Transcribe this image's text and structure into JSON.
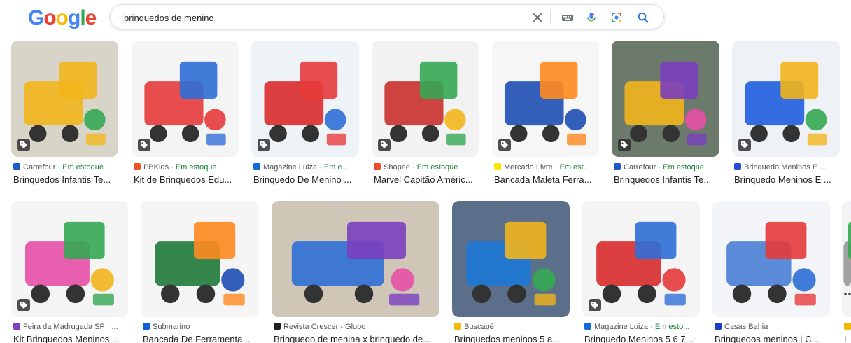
{
  "search": {
    "query": "brinquedos de menino",
    "logo_letters": [
      "G",
      "o",
      "o",
      "g",
      "l",
      "e"
    ],
    "logo_colors": [
      "#4285F4",
      "#EA4335",
      "#FBBC05",
      "#4285F4",
      "#34A853",
      "#EA4335"
    ],
    "icons": [
      "close-icon",
      "keyboard-icon",
      "microphone-icon",
      "lens-icon",
      "search-icon"
    ]
  },
  "colors": {
    "accent": "#1a73e8",
    "stock_green": "#188038",
    "source_gray": "#4d5156"
  },
  "row1": [
    {
      "source": "Carrefour",
      "stock": " · Em estoque",
      "title": "Brinquedos Infantis Te...",
      "fav": "#1e5bc6",
      "bg": "#d9d4c8",
      "accent": "#f2b51c"
    },
    {
      "source": "PBKids",
      "stock": " · Em estoque",
      "title": "Kit de Brinquedos Edu...",
      "fav": "#e8552b",
      "bg": "#f4f4f4",
      "accent": "#e63b3b"
    },
    {
      "source": "Magazine Luiza",
      "stock": " · Em e...",
      "title": "Brinquedo De Menino ...",
      "fav": "#0f6bd6",
      "bg": "#eef3f8",
      "accent": "#d92b2b"
    },
    {
      "source": "Shopee",
      "stock": " · Em estoque",
      "title": "Marvel Capitão Améric...",
      "fav": "#ee4d2d",
      "bg": "#f2f2f2",
      "accent": "#c9302c"
    },
    {
      "source": "Mercado Livre",
      "stock": " · Em est...",
      "title": "Bancada Maleta Ferra...",
      "fav": "#ffe600",
      "bg": "#f6f6f6",
      "accent": "#1e4fb5"
    },
    {
      "source": "Carrefour",
      "stock": " · Em estoque",
      "title": "Brinquedos Infantis Te...",
      "fav": "#1e5bc6",
      "bg": "#6b7a6a",
      "accent": "#f2b51c"
    },
    {
      "source": "Brinquedo Meninos E ...",
      "stock": "",
      "title": "Brinquedo Meninos E ...",
      "fav": "#2a4bd7",
      "bg": "#eef1f6",
      "accent": "#1f5ee0"
    }
  ],
  "row2": [
    {
      "source": "Feira da Madrugada SP · ...",
      "stock": "",
      "title": "Kit Brinquedos Meninos ...",
      "fav": "#7b3fbf",
      "bg": "#f4f4f4",
      "accent": "#e64fa6"
    },
    {
      "source": "Submarino",
      "stock": "",
      "title": "Bancada De Ferramenta...",
      "fav": "#0e5fd8",
      "bg": "#f5f5f5",
      "accent": "#1f7a3a"
    },
    {
      "source": "Revista Crescer - Globo",
      "stock": "",
      "title": "Brinquedo de menina x brinquedo de...",
      "fav": "#202124",
      "bg": "#cfc6b8",
      "accent": "#2f6fd6"
    },
    {
      "source": "Buscapé",
      "stock": "",
      "title": "Brinquedos meninos 5 a...",
      "fav": "#f5b800",
      "bg": "#5b6f8a",
      "accent": "#1e78d6"
    },
    {
      "source": "Magazine Luiza",
      "stock": " · Em esto...",
      "title": "Brinquedo Meninos 5 6 7...",
      "fav": "#0f6bd6",
      "bg": "#f4f4f4",
      "accent": "#d92b2b"
    },
    {
      "source": "Casas Bahia",
      "stock": "",
      "title": "Brinquedos meninos | C...",
      "fav": "#1b3fbf",
      "bg": "#f3f5f8",
      "accent": "#4a7fd4"
    },
    {
      "source": "",
      "stock": "",
      "title": "L",
      "fav": "#f5b800",
      "bg": "#f1f3f4",
      "accent": "#999999"
    }
  ]
}
